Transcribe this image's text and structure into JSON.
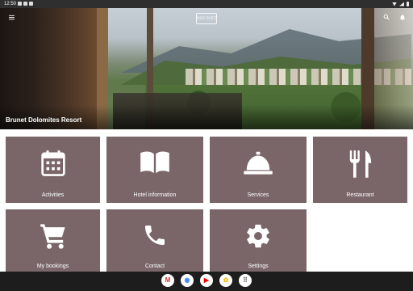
{
  "status_bar": {
    "time": "12:50"
  },
  "hero": {
    "title": "Brunet Dolomites Resort",
    "logo_text": "BRUNET",
    "menu_icon": "hamburger-menu-icon",
    "search_icon": "search-icon",
    "notification_icon": "bell-icon"
  },
  "tiles": [
    {
      "label": "Activities",
      "icon": "calendar-icon"
    },
    {
      "label": "Hotel information",
      "icon": "book-icon"
    },
    {
      "label": "Services",
      "icon": "service-bell-icon"
    },
    {
      "label": "Restaurant",
      "icon": "fork-knife-icon"
    },
    {
      "label": "My bookings",
      "icon": "shopping-cart-icon"
    },
    {
      "label": "Contact",
      "icon": "phone-icon"
    },
    {
      "label": "Settings",
      "icon": "gear-icon"
    }
  ],
  "tile_color": "#7a6669",
  "dock": {
    "apps": [
      {
        "name": "gmail-icon",
        "color": "#d93025",
        "glyph": "M"
      },
      {
        "name": "chrome-icon",
        "color": "#4285f4",
        "glyph": "◉"
      },
      {
        "name": "youtube-icon",
        "color": "#ff0000",
        "glyph": "▶"
      },
      {
        "name": "photos-icon",
        "color": "#fbbc04",
        "glyph": "✿"
      },
      {
        "name": "app-drawer-icon",
        "color": "#5f6368",
        "glyph": "⠿"
      }
    ]
  }
}
